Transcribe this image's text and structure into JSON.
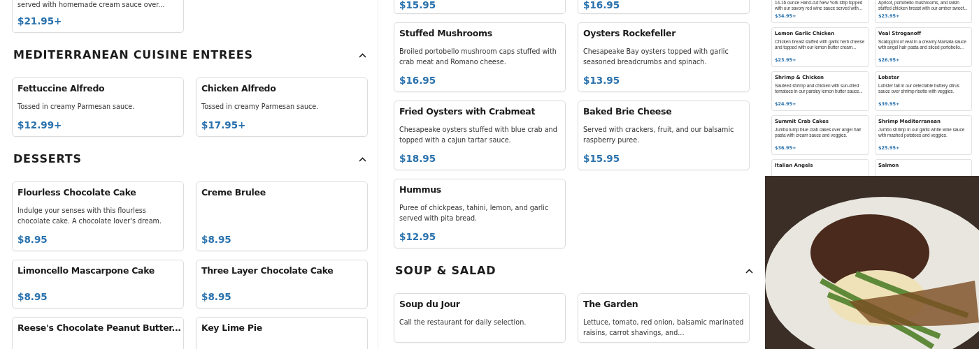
{
  "columns": [
    {
      "blocks": [
        {
          "kind": "items",
          "items": [
            {
              "description": "served with homemade cream sauce over...",
              "price": "$21.95+"
            }
          ]
        },
        {
          "kind": "section",
          "title": "MEDITERRANEAN CUISINE ENTREES",
          "expanded": true,
          "items": [
            {
              "name": "Fettuccine Alfredo",
              "description": "Tossed in creamy Parmesan sauce.",
              "price": "$12.99+"
            },
            {
              "name": "Chicken Alfredo",
              "description": "Tossed in creamy Parmesan sauce.",
              "price": "$17.95+"
            }
          ]
        },
        {
          "kind": "section",
          "title": "DESSERTS",
          "expanded": true,
          "items": [
            {
              "name": "Flourless Chocolate Cake",
              "description": "Indulge your senses with this flourless chocolate cake. A chocolate lover's dream.",
              "price": "$8.95"
            },
            {
              "name": "Creme Brulee",
              "price": "$8.95"
            },
            {
              "name": "Limoncello Mascarpone Cake",
              "price": "$8.95"
            },
            {
              "name": "Three Layer Chocolate Cake",
              "price": "$8.95"
            },
            {
              "name": "Reese's Chocolate Peanut Butter..."
            },
            {
              "name": "Key Lime Pie"
            }
          ]
        }
      ]
    },
    {
      "blocks": [
        {
          "kind": "items",
          "items": [
            {
              "price": "$15.95"
            },
            {
              "price": "$16.95"
            },
            {
              "name": "Stuffed Mushrooms",
              "description": "Broiled portobello mushroom caps stuffed with crab meat and Romano cheese.",
              "price": "$16.95"
            },
            {
              "name": "Oysters Rockefeller",
              "description": "Chesapeake Bay oysters topped with garlic seasoned breadcrumbs and spinach.",
              "price": "$13.95"
            },
            {
              "name": "Fried Oysters with Crabmeat",
              "description": "Chesapeake oysters stuffed with blue crab and topped with a cajun tartar sauce.",
              "price": "$18.95"
            },
            {
              "name": "Baked Brie Cheese",
              "description": "Served with crackers, fruit, and our balsamic raspberry puree.",
              "price": "$15.95"
            },
            {
              "name": "Hummus",
              "description": "Puree of chickpeas, tahini, lemon, and garlic served with pita bread.",
              "price": "$12.95"
            }
          ]
        },
        {
          "kind": "section",
          "title": "SOUP & SALAD",
          "expanded": true,
          "items": [
            {
              "name": "Soup du Jour",
              "description": "Call the restaurant for daily selection."
            },
            {
              "name": "The Garden",
              "description": "Lettuce, tomato, red onion, balsamic marinated raisins, carrot shavings, and..."
            }
          ]
        }
      ]
    }
  ],
  "featured": {
    "items": [
      {
        "description": "14-16 ounce Hand-cut New York strip topped with our savory red wine sauce served with...",
        "price": "$34.95+"
      },
      {
        "description": "Apricot, portobello mushrooms, and raisin stuffed chicken breast with our amber sweet...",
        "price": "$23.95+"
      },
      {
        "name": "Lemon Garlic Chicken",
        "description": "Chicken breast stuffed with garlic herb cheese and topped with our lemon butter cream...",
        "price": "$23.95+"
      },
      {
        "name": "Veal Stroganoff",
        "description": "Scaloppini of veal in a creamy Marsala sauce with angel hair pasta and sliced portobello...",
        "price": "$26.95+"
      },
      {
        "name": "Shrimp & Chicken",
        "description": "Sautéed shrimp and chicken with sun-dried tomatoes in our parsley lemon butter sauce...",
        "price": "$24.95+"
      },
      {
        "name": "Lobster",
        "description": "Lobster tail in our delectable buttery citrus sauce over shrimp risotto with veggies.",
        "price": "$39.95+"
      },
      {
        "name": "Summit Crab Cakes",
        "description": "Jumbo lump blue crab cakes over angel hair pasta with cream sauce and veggies.",
        "price": "$36.95+"
      },
      {
        "name": "Shrimp Mediterranean",
        "description": "Jumbo shrimp in our garlic white wine sauce with mashed potatoes and veggies.",
        "price": "$25.95+"
      },
      {
        "name": "Italian Angels"
      },
      {
        "name": "Salmon"
      }
    ]
  }
}
